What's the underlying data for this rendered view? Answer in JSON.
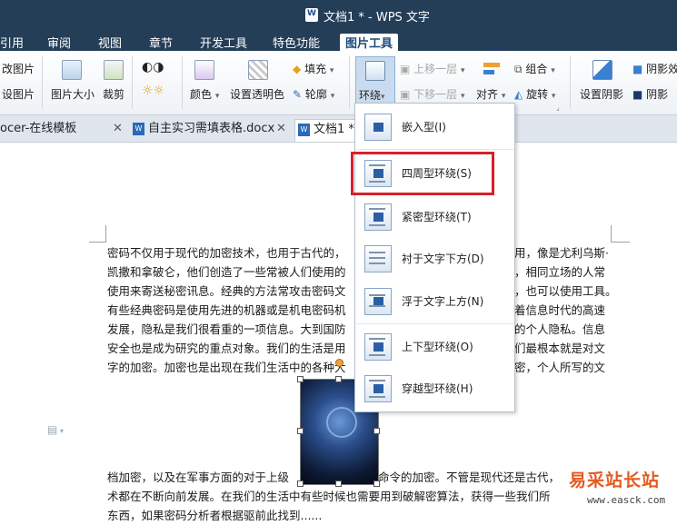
{
  "window": {
    "title": "文档1 * - WPS 文字"
  },
  "ribbon_tabs": [
    "引用",
    "审阅",
    "视图",
    "章节",
    "开发工具",
    "特色功能",
    "图片工具"
  ],
  "ribbon": {
    "change_picture": "改图片",
    "reset_picture": "设图片",
    "picture_size": "图片大小",
    "crop": "裁剪",
    "color": "颜色",
    "set_transparent": "设置透明色",
    "fill": "填充",
    "outline": "轮廓",
    "wrap": "环绕",
    "bring_forward": "上移一层",
    "send_backward": "下移一层",
    "align": "对齐",
    "group": "组合",
    "rotate": "旋转",
    "set_shadow": "设置阴影",
    "shadow_right_1": "阴影效",
    "shadow_right_2": "阴影"
  },
  "doc_tabs": [
    {
      "label": "ocer-在线模板"
    },
    {
      "label": "自主实习需填表格.docx"
    },
    {
      "label": "文档1 *"
    }
  ],
  "wrap_menu": {
    "items": [
      {
        "label": "嵌入型(I)",
        "icon": "inline-wrap-icon"
      },
      {
        "label": "四周型环绕(S)",
        "icon": "square-wrap-icon"
      },
      {
        "label": "紧密型环绕(T)",
        "icon": "tight-wrap-icon"
      },
      {
        "label": "衬于文字下方(D)",
        "icon": "behind-text-icon"
      },
      {
        "label": "浮于文字上方(N)",
        "icon": "in-front-of-text-icon"
      },
      {
        "label": "上下型环绕(O)",
        "icon": "top-bottom-wrap-icon"
      },
      {
        "label": "穿越型环绕(H)",
        "icon": "through-wrap-icon"
      }
    ]
  },
  "document": {
    "upper_lines": [
      "密码不仅用于现代的加密技术，也用于古代的，",
      "凯撒和拿破仑，他们创造了一些常被人们使用的",
      "使用来寄送秘密讯息。经典的方法常攻击密码文",
      "有些经典密码是使用先进的机器或是机电密码机",
      "发展，隐私是我们很看重的一项信息。大到国防",
      "安全也是成为研究的重点对象。我们的生活是用",
      "字的加密。加密也是出现在我们生活中的各种大"
    ],
    "upper_right_fragments": [
      "用，像是尤利乌斯·",
      "，相同立场的人常",
      "，也可以使用工具。",
      "着信息时代的高速",
      "的个人隐私。信息",
      "们最根本就是对文",
      "密，个人所写的文"
    ],
    "lower_lines_left": [
      "档加密，以及在军事方面的对于上级",
      "术都在不断向前发展。在我们的生活中有些时候也需要用到破解密算法，获得一些我们所",
      "东西，如果密码分析者根据驱前此找到......"
    ],
    "lower_right_fragment": "命令的加密。不管是现代还是古代，"
  },
  "watermark": {
    "text": "易采站长站",
    "url": "www.easck.com"
  },
  "colors": {
    "titlebar": "#253e58",
    "highlight": "#d9202a",
    "accent": "#2b6ab8",
    "watermark": "#e35a1f"
  }
}
